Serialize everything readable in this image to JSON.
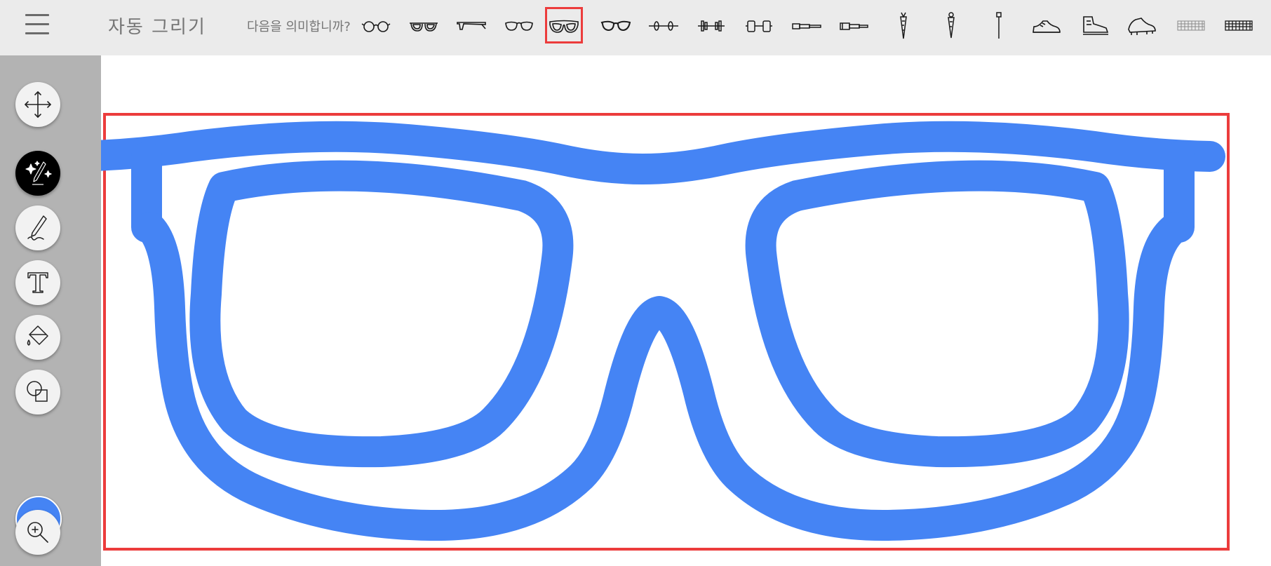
{
  "app": {
    "title": "자동 그리기"
  },
  "header": {
    "menu_icon": "hamburger-menu-icon"
  },
  "suggestions": {
    "prompt": "다음을 의미합니까?",
    "items": [
      {
        "name": "round-glasses",
        "selected": false
      },
      {
        "name": "thick-frame-glasses",
        "selected": false
      },
      {
        "name": "side-view-glasses",
        "selected": false
      },
      {
        "name": "aviator-sunglasses",
        "selected": false
      },
      {
        "name": "wayfarer-glasses",
        "selected": true
      },
      {
        "name": "cat-eye-glasses",
        "selected": false
      },
      {
        "name": "barbell",
        "selected": false
      },
      {
        "name": "dumbbell-plates",
        "selected": false
      },
      {
        "name": "dumbbell",
        "selected": false
      },
      {
        "name": "telescope",
        "selected": false
      },
      {
        "name": "spyglass",
        "selected": false
      },
      {
        "name": "carrot",
        "selected": false
      },
      {
        "name": "carrot-alt",
        "selected": false
      },
      {
        "name": "pin",
        "selected": false
      },
      {
        "name": "sneaker",
        "selected": false
      },
      {
        "name": "high-top-sneaker",
        "selected": false
      },
      {
        "name": "cleat-shoe",
        "selected": false
      },
      {
        "name": "keyboard-thin",
        "selected": false
      },
      {
        "name": "keyboard",
        "selected": false
      }
    ]
  },
  "tools": [
    {
      "name": "move-tool",
      "icon": "move-arrows-icon",
      "active": false
    },
    {
      "name": "autodraw-tool",
      "icon": "sparkle-pencil-icon",
      "active": true
    },
    {
      "name": "draw-tool",
      "icon": "pencil-icon",
      "active": false
    },
    {
      "name": "text-tool",
      "icon": "text-icon",
      "active": false
    },
    {
      "name": "fill-tool",
      "icon": "paint-bucket-icon",
      "active": false
    },
    {
      "name": "shape-tool",
      "icon": "shapes-icon",
      "active": false
    },
    {
      "name": "color-picker",
      "icon": "color-swatch",
      "active": false
    },
    {
      "name": "zoom-tool",
      "icon": "zoom-in-icon",
      "active": false
    }
  ],
  "colors": {
    "stroke": "#4584f4",
    "selection": "#ec3c3c",
    "toolbar_bg": "#ebebeb",
    "sidebar_bg": "#b3b3b3"
  },
  "canvas": {
    "drawing": "wayfarer-glasses"
  }
}
